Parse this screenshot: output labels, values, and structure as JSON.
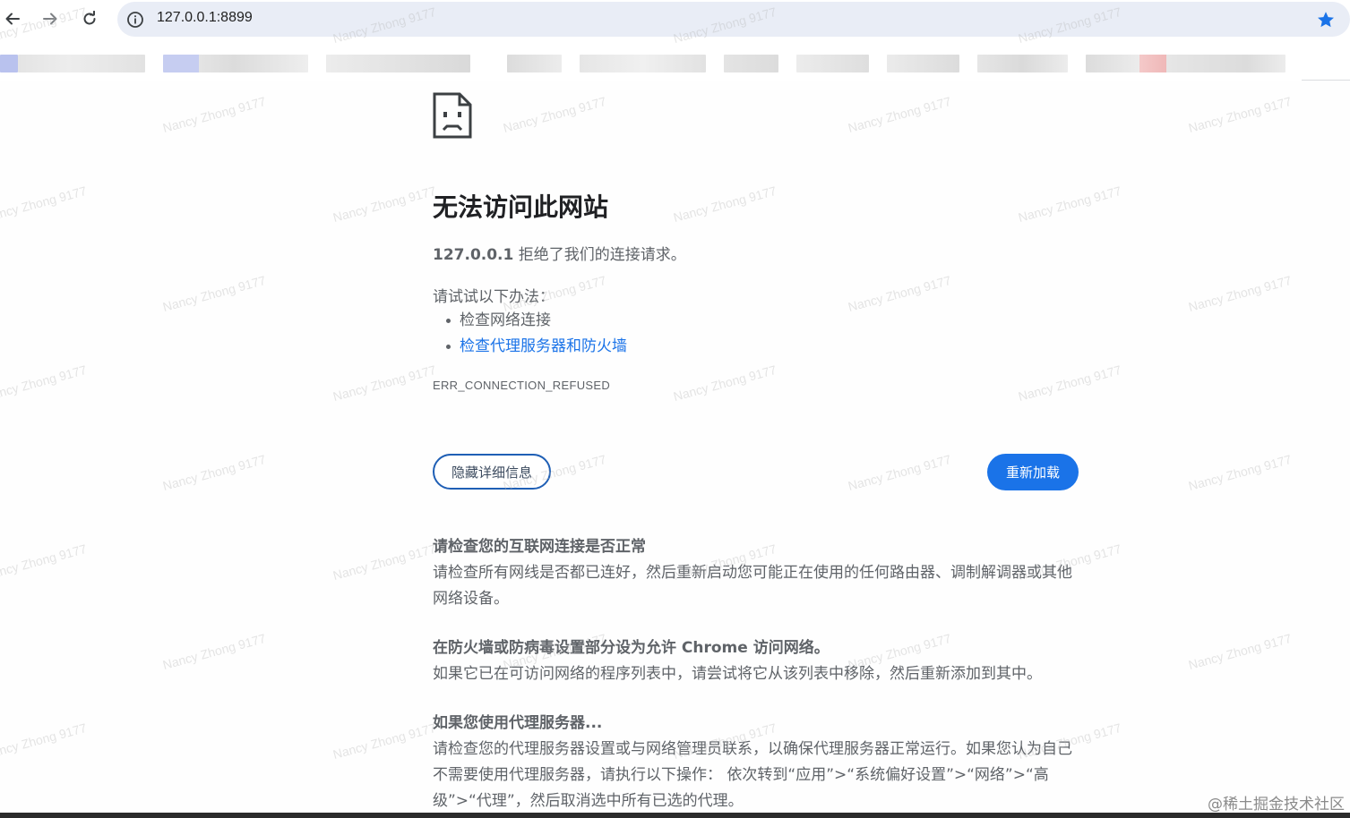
{
  "browser": {
    "url": "127.0.0.1:8899",
    "back_icon": "arrow-left-icon",
    "forward_icon": "arrow-right-icon",
    "reload_icon": "reload-icon",
    "info_icon": "info-circle-icon",
    "bookmark_icon": "star-icon",
    "accent": "#1a73e8"
  },
  "error_page": {
    "icon": "sad-document-icon",
    "title": "无法访问此网站",
    "host": "127.0.0.1",
    "subtitle_rest": " 拒绝了我们的连接请求。",
    "try_label": "请试试以下办法：",
    "suggestions": [
      "检查网络连接",
      "检查代理服务器和防火墙"
    ],
    "error_code": "ERR_CONNECTION_REFUSED",
    "details_button": "隐藏详细信息",
    "reload_button": "重新加载",
    "sections": [
      {
        "heading": "请检查您的互联网连接是否正常",
        "body": "请检查所有网线是否都已连好，然后重新启动您可能正在使用的任何路由器、调制解调器或其他网络设备。"
      },
      {
        "heading": "在防火墙或防病毒设置部分设为允许 Chrome 访问网络。",
        "body": "如果它已在可访问网络的程序列表中，请尝试将它从该列表中移除，然后重新添加到其中。"
      },
      {
        "heading": "如果您使用代理服务器...",
        "body": "请检查您的代理服务器设置或与网络管理员联系，以确保代理服务器正常运行。如果您认为自己不需要使用代理服务器，请执行以下操作：  依次转到“应用”>“系统偏好设置”>“网络”>“高级”>“代理”，然后取消选中所有已选的代理。"
      }
    ]
  },
  "watermark": "Nancy Zhong 9177",
  "attribution": "@稀土掘金技术社区"
}
